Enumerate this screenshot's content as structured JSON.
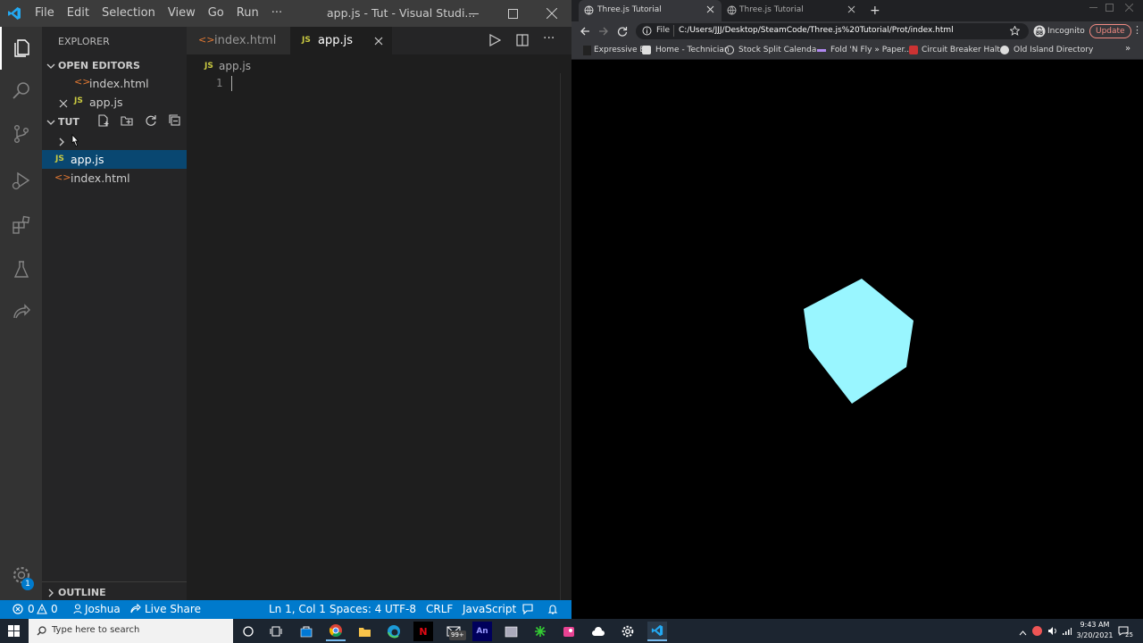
{
  "vscode": {
    "menu": [
      "File",
      "Edit",
      "Selection",
      "View",
      "Go",
      "Run",
      "···"
    ],
    "title": "app.js - Tut - Visual Studi...",
    "sidebar": {
      "header": "EXPLORER",
      "open_editors_label": "OPEN EDITORS",
      "open_editors": [
        {
          "label": "index.html",
          "type": "html"
        },
        {
          "label": "app.js",
          "type": "js"
        }
      ],
      "folder_label": "TUT",
      "files": [
        {
          "label": "app.js",
          "type": "js",
          "selected": true
        },
        {
          "label": "index.html",
          "type": "html",
          "selected": false
        }
      ],
      "outline_label": "OUTLINE"
    },
    "tabs": [
      {
        "label": "index.html",
        "type": "html",
        "active": false
      },
      {
        "label": "app.js",
        "type": "js",
        "active": true
      }
    ],
    "breadcrumb": "app.js",
    "line_number": "1",
    "icon_js_text": "JS",
    "settings_badge": "1",
    "status": {
      "errors": "0",
      "warnings": "0",
      "user": "Joshua",
      "live_share": "Live Share",
      "position": "Ln 1, Col 1",
      "spaces": "Spaces: 4",
      "encoding": "UTF-8",
      "eol": "CRLF",
      "language": "JavaScript"
    }
  },
  "chrome": {
    "tabs": [
      {
        "label": "Three.js Tutorial",
        "active": true
      },
      {
        "label": "Three.js Tutorial",
        "active": false
      }
    ],
    "file_label": "File",
    "url": "C:/Users/JJJ/Desktop/SteamCode/Three.js%20Tutorial/Prot/index.html",
    "incognito": "Incognito",
    "update": "Update",
    "bookmarks": [
      "Expressive E",
      "Home - Technician",
      "Stock Split Calenda...",
      "Fold 'N Fly » Paper...",
      "Circuit Breaker Halt...",
      "Old Island Directory"
    ],
    "cube_color": "#99f6ff"
  },
  "taskbar": {
    "search_placeholder": "Type here to search",
    "mail_badge": "99+",
    "app_an": "An",
    "time": "9:43 AM",
    "date": "3/20/2021",
    "notif_count": "25"
  },
  "colors": {
    "vscode_accent": "#007acc",
    "js_yellow": "#cbcb41",
    "html_orange": "#e37933",
    "selected_row": "#094771"
  }
}
